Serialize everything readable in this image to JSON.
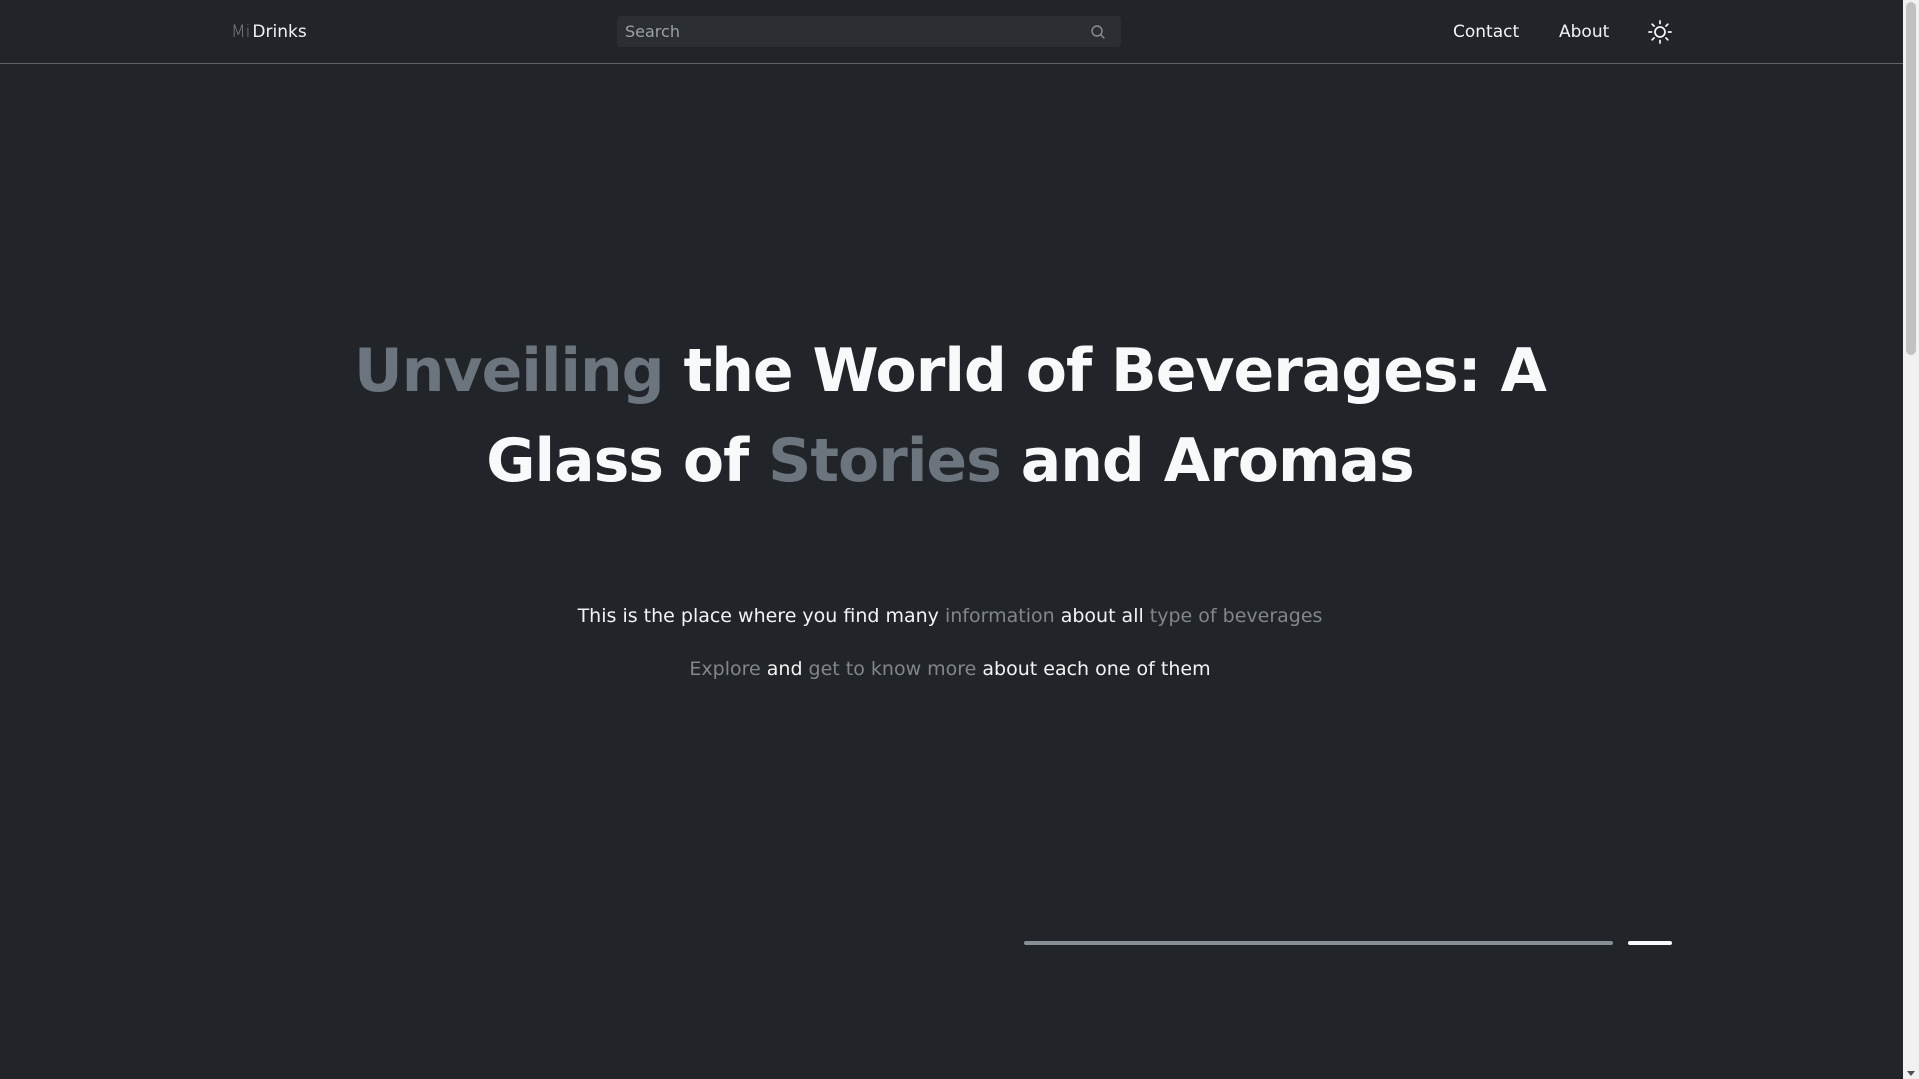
{
  "header": {
    "logo": {
      "prefix": "Mi",
      "name": "Drinks"
    },
    "search": {
      "placeholder": "Search",
      "value": "",
      "icon": "search-icon"
    },
    "nav": {
      "contact": "Contact",
      "about": "About"
    },
    "theme_toggle": {
      "icon": "sun-icon"
    }
  },
  "hero": {
    "title": {
      "w1": "Unveiling",
      "w2": " the World of Beverages: A Glass of ",
      "w3": "Stories",
      "w4": " and Aromas"
    },
    "line1": {
      "a": "This is the place where you find many ",
      "b": "information",
      "c": " about all ",
      "d": "type of beverages"
    },
    "line2": {
      "a": "Explore",
      "b": " and ",
      "c": "get to know more",
      "d": " about each one of them"
    }
  },
  "carousel": {
    "slides": 2,
    "active_index": 1
  },
  "colors": {
    "background": "#212529",
    "text": "#f8f9fa",
    "muted": "#6c757d"
  }
}
